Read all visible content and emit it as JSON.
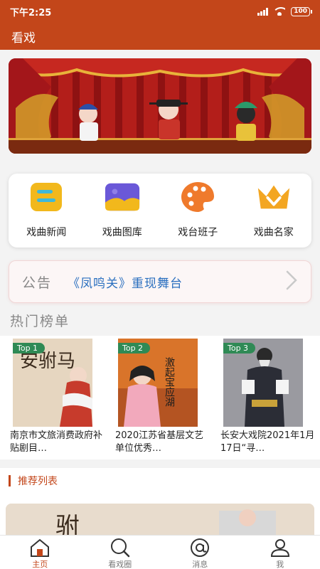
{
  "status_bar": {
    "time": "下午2:25",
    "battery": "100"
  },
  "app_bar": {
    "title": "看戏"
  },
  "shortcuts": [
    {
      "label": "戏曲新闻",
      "icon": "news-icon",
      "color": "#f2b81c"
    },
    {
      "label": "戏曲图库",
      "icon": "gallery-icon",
      "color": "#6a58d8"
    },
    {
      "label": "戏台班子",
      "icon": "palette-icon",
      "color": "#ef7a2c"
    },
    {
      "label": "戏曲名家",
      "icon": "crown-icon",
      "color": "#f3a622"
    }
  ],
  "notice": {
    "tag": "公告",
    "text": "《凤鸣关》重现舞台"
  },
  "hot": {
    "title": "热门榜单",
    "items": [
      {
        "badge": "Top 1",
        "caption": "南京市文旅消费政府补贴剧目…",
        "poster_text": "安驸马"
      },
      {
        "badge": "Top 2",
        "caption": "2020江苏省基层文艺单位优秀…",
        "poster_text": "激起宝应湖"
      },
      {
        "badge": "Top 3",
        "caption": "长安大戏院2021年1月17日“寻…",
        "poster_text": ""
      }
    ]
  },
  "recommend": {
    "title": "推荐列表"
  },
  "tabs": [
    {
      "label": "主页",
      "icon": "home-icon",
      "active": true
    },
    {
      "label": "看戏圈",
      "icon": "search-icon",
      "active": false
    },
    {
      "label": "消息",
      "icon": "at-icon",
      "active": false
    },
    {
      "label": "我",
      "icon": "user-icon",
      "active": false
    }
  ],
  "colors": {
    "brand": "#c3461a",
    "link": "#2a6fbf",
    "badge": "#2f8a55"
  }
}
